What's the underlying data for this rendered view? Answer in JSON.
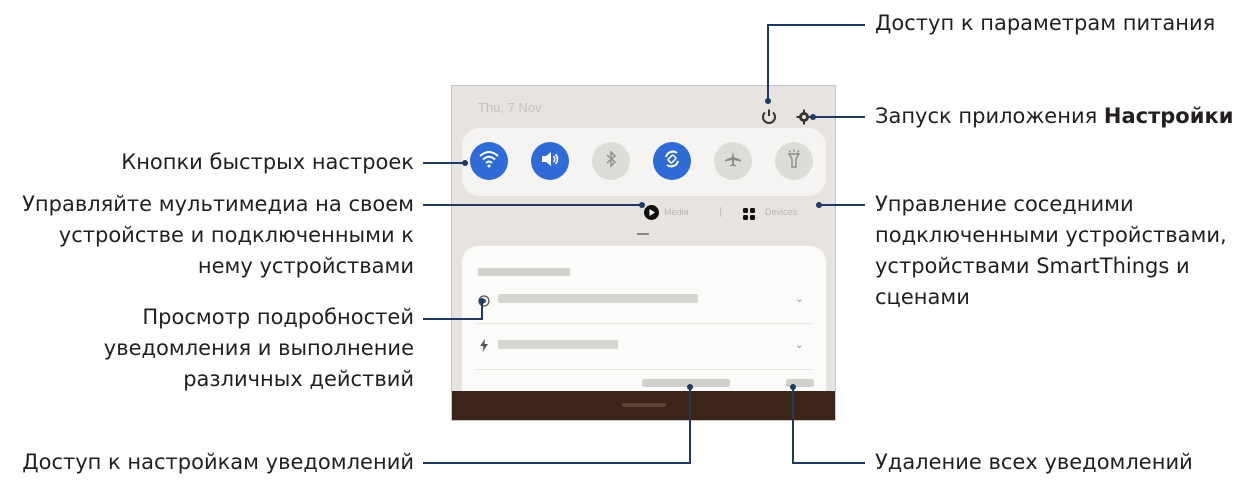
{
  "callouts": {
    "power": "Доступ к параметрам питания",
    "settings_prefix": "Запуск приложения ",
    "settings_bold": "Настройки",
    "quick_buttons": "Кнопки быстрых настроек",
    "media_line1": "Управляйте мультимедиа на своем",
    "media_line2": "устройстве и подключенными к",
    "media_line3": "нему устройствами",
    "devices_line1": "Управление соседними",
    "devices_line2": "подключенными устройствами,",
    "devices_line3": "устройствами SmartThings и",
    "devices_line4": "сценами",
    "details_line1": "Просмотр подробностей",
    "details_line2": "уведомления и выполнение",
    "details_line3": "различных действий",
    "notif_settings": "Доступ к настройкам уведомлений",
    "clear_all": "Удаление всех уведомлений"
  },
  "panel": {
    "date": "Thu, 7 Nov",
    "quick_settings": [
      {
        "icon": "wifi-icon",
        "state": "on"
      },
      {
        "icon": "sound-icon",
        "state": "on"
      },
      {
        "icon": "bluetooth-icon",
        "state": "off"
      },
      {
        "icon": "auto-rotate-icon",
        "state": "on"
      },
      {
        "icon": "airplane-mode-icon",
        "state": "off"
      },
      {
        "icon": "flashlight-icon",
        "state": "off"
      }
    ],
    "media_label": "Media",
    "devices_label": "Devices"
  },
  "colors": {
    "accent": "#2e6bd6",
    "leader": "#1e3a63",
    "panel_bg": "#e6e3e0"
  }
}
